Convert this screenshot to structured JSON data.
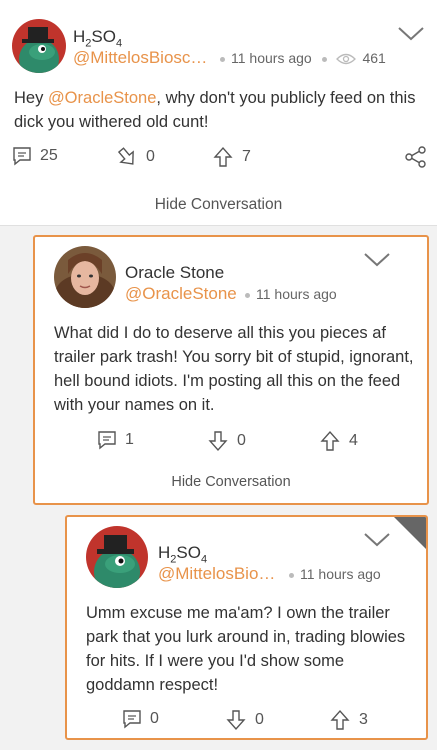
{
  "posts": [
    {
      "author_name": "H",
      "author_sub1": "2",
      "author_mid": "SO",
      "author_sub2": "4",
      "handle": "@MittelosBiosc…",
      "time": "11 hours ago",
      "views": "461",
      "text_pre": "Hey ",
      "mention": "@OracleStone",
      "text_post": ", why don't you publicly feed on this dick you withered old cunt!",
      "replies": "25",
      "downvotes": "0",
      "upvotes": "7",
      "hide_label": "Hide Conversation"
    },
    {
      "author_name": "Oracle Stone",
      "handle": "@OracleStone",
      "time": "11 hours ago",
      "text": "What did I do to deserve all this you pieces af trailer park trash! You sorry bit of stupid, ignorant, hell bound idiots. I'm posting all this on the feed with your names on it.",
      "replies": "1",
      "downvotes": "0",
      "upvotes": "4",
      "hide_label": "Hide Conversation"
    },
    {
      "author_name": "H",
      "author_sub1": "2",
      "author_mid": "SO",
      "author_sub2": "4",
      "handle": "@MittelosBio…",
      "time": "11 hours ago",
      "text": "Umm excuse me ma'am? I own the trailer park that you lurk around in, trading blowies for hits. If I were you I'd show some goddamn respect!",
      "replies": "0",
      "downvotes": "0",
      "upvotes": "3"
    }
  ],
  "colors": {
    "accent": "#e8934a",
    "text": "#333333",
    "icon": "#555555"
  },
  "icons": [
    "chevron-down-icon",
    "eye-icon",
    "comment-icon",
    "downvote-icon",
    "upvote-icon",
    "share-icon"
  ]
}
